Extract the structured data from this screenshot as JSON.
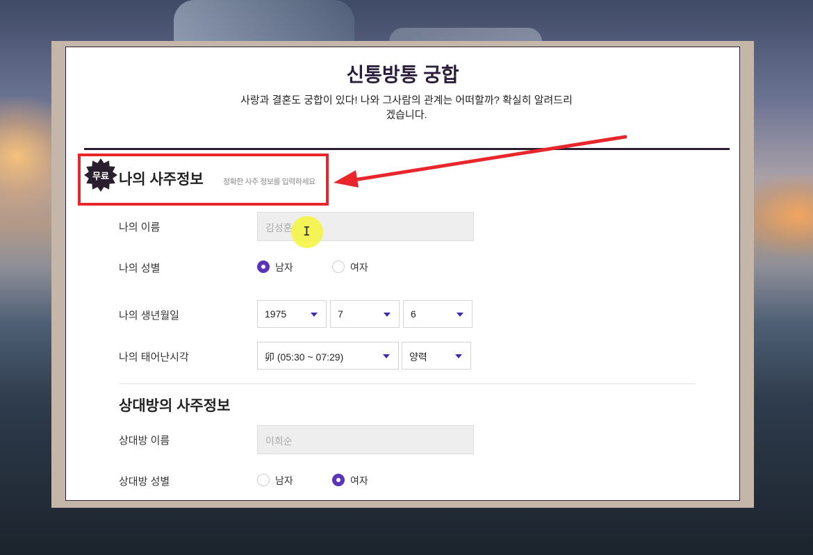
{
  "header": {
    "title": "신통방통 궁합",
    "subtitle": "사랑과 결혼도 궁합이 있다! 나와 그사람의 관계는 어떠할까? 확실히 알려드리겠습니다."
  },
  "my_section": {
    "badge": "무료",
    "title": "나의 사주정보",
    "hint": "정확한 사주 정보를 입력하세요",
    "name_label": "나의 이름",
    "name_value": "김성훈",
    "gender_label": "나의 성별",
    "gender_options": [
      "남자",
      "여자"
    ],
    "gender_selected": "남자",
    "birth_label": "나의 생년월일",
    "birth_year": "1975",
    "birth_month": "7",
    "birth_day": "6",
    "time_label": "나의 태어난시각",
    "time_value": "卯 (05:30 ~ 07:29)",
    "calendar_value": "양력"
  },
  "partner_section": {
    "title": "상대방의 사주정보",
    "name_label": "상대방 이름",
    "name_value": "이희순",
    "gender_label": "상대방 성별",
    "gender_options": [
      "남자",
      "여자"
    ],
    "gender_selected": "여자"
  },
  "colors": {
    "accent": "#5b34b8",
    "annotation": "#e8262b",
    "badge": "#2a1f2e"
  },
  "icons": [
    "badge-star-icon",
    "caret-down-icon",
    "arrow-annotation-icon",
    "text-cursor-icon"
  ]
}
